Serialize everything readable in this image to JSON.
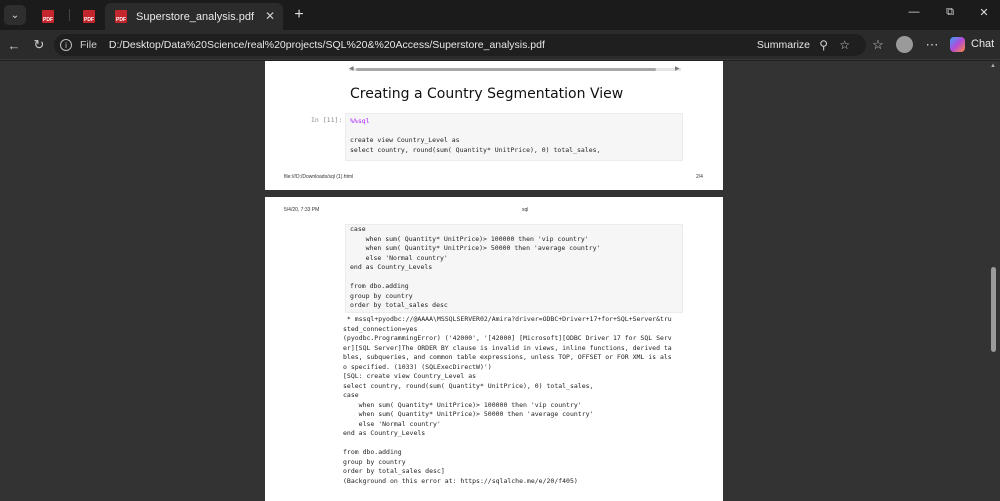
{
  "tabs": [
    {
      "type": "pdf"
    },
    {
      "type": "pdf"
    },
    {
      "type": "pdf",
      "title": "Superstore_analysis.pdf",
      "active": true
    }
  ],
  "address": {
    "label": "File",
    "url": "D:/Desktop/Data%20Science/real%20projects/SQL%20&%20Access/Superstore_analysis.pdf",
    "summarize": "Summarize"
  },
  "chat_label": "Chat",
  "page1": {
    "heading": "Creating a Country Segmentation View",
    "prompt": "In [11]:",
    "code": [
      "%%sql",
      "",
      "create view Country_Level as",
      "select country, round(sum( Quantity* UnitPrice), 0) total_sales,"
    ],
    "footer_left": "file:///D:/Downloads/sql (1).html",
    "footer_right": "2/4"
  },
  "page2": {
    "header_left": "5/4/20, 7:33 PM",
    "header_center": "sql",
    "code": [
      "case",
      "    when sum( Quantity* UnitPrice)> 100000 then 'vip country'",
      "    when sum( Quantity* UnitPrice)> 50000 then 'average country'",
      "    else 'Normal country'",
      "end as Country_Levels",
      "",
      "from dbo.adding",
      "group by country",
      "order by total_sales desc"
    ],
    "output": [
      " * mssql+pyodbc://@AAAA\\MSSQLSERVER02/Amira?driver=ODBC+Driver+17+for+SQL+Server&tru",
      "sted_connection=yes",
      "(pyodbc.ProgrammingError) ('42000', '[42000] [Microsoft][ODBC Driver 17 for SQL Serv",
      "er][SQL Server]The ORDER BY clause is invalid in views, inline functions, derived ta",
      "bles, subqueries, and common table expressions, unless TOP, OFFSET or FOR XML is als",
      "o specified. (1033) (SQLExecDirectW)')",
      "[SQL: create view Country_Level as",
      "select country, round(sum( Quantity* UnitPrice), 0) total_sales,",
      "case",
      "    when sum( Quantity* UnitPrice)> 100000 then 'vip country'",
      "    when sum( Quantity* UnitPrice)> 50000 then 'average country'",
      "    else 'Normal country'",
      "end as Country_Levels",
      "",
      "from dbo.adding",
      "group by country",
      "order by total_sales desc]",
      "(Background on this error at: https://sqlalche.me/e/20/f405)"
    ]
  }
}
